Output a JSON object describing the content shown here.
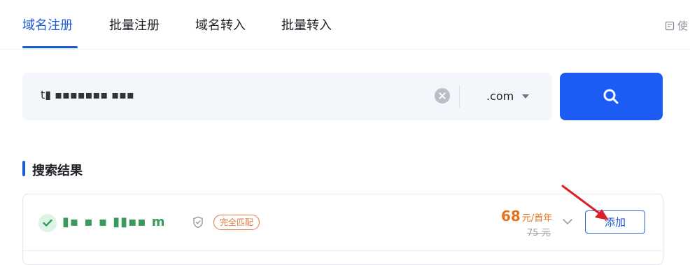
{
  "tabs": [
    {
      "label": "域名注册",
      "active": true
    },
    {
      "label": "批量注册",
      "active": false
    },
    {
      "label": "域名转入",
      "active": false
    },
    {
      "label": "批量转入",
      "active": false
    }
  ],
  "doc_link": {
    "label": "使",
    "icon": "document-icon"
  },
  "search": {
    "value": "t▮ ▪▪▪▪▪▪▪ ▪▪▪",
    "tld": ".com",
    "clear_icon": "close-circle-icon",
    "search_icon": "search-icon"
  },
  "section": {
    "title": "搜索结果"
  },
  "result": {
    "domain": "▮▪  ▪  ▪  ▮▮▪▪  m",
    "match_badge": "完全匹配",
    "price": "68",
    "price_unit": "元/首年",
    "old_price": "75 元",
    "add_label": "添加"
  },
  "colors": {
    "accent": "#1c5cf5",
    "available": "#3a9a5c",
    "price": "#e5731c",
    "annotation_arrow": "#d9202b"
  }
}
